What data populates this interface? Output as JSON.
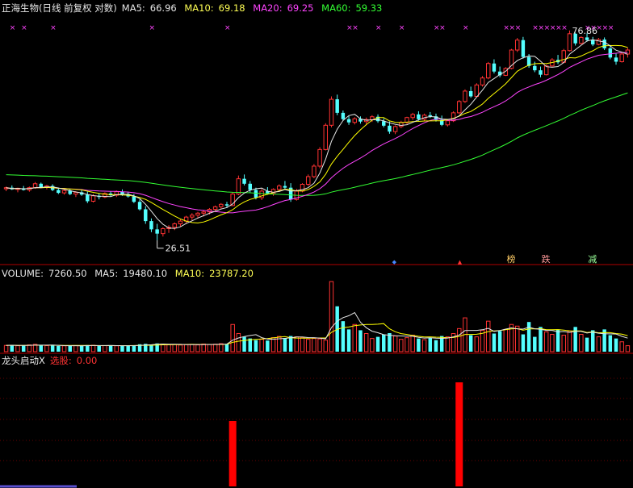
{
  "price_header": {
    "title": "正海生物(日线 前复权 对数)",
    "ma5_label": "MA5:",
    "ma5": "66.96",
    "ma10_label": "MA10:",
    "ma10": "69.18",
    "ma20_label": "MA20:",
    "ma20": "69.25",
    "ma60_label": "MA60:",
    "ma60": "59.33"
  },
  "volume_header": {
    "volume_label": "VOLUME:",
    "volume": "7260.50",
    "ma5_label": "MA5:",
    "ma5": "19480.10",
    "ma10_label": "MA10:",
    "ma10": "23787.20"
  },
  "indicator_header": {
    "name": "龙头启动X",
    "signal_label": "选股:",
    "signal_value": "0.00"
  },
  "annotations": {
    "low_price": "26.51",
    "high_price": "76.86"
  },
  "event_tags": [
    "榜",
    "跌",
    "减"
  ],
  "colors": {
    "background": "#000000",
    "up": "#ff3232",
    "down": "#54ffff",
    "ma5": "#e6e6e6",
    "ma10": "#ffff00",
    "ma20": "#ff44ff",
    "ma60": "#33ff33",
    "separator": "#b00000",
    "signal_bar": "#ff0000"
  },
  "chart_data": [
    {
      "type": "candlestick",
      "scale": "log",
      "ylim": [
        24,
        82
      ],
      "ma_series": [
        {
          "name": "MA5",
          "last": 66.96
        },
        {
          "name": "MA10",
          "last": 69.18
        },
        {
          "name": "MA20",
          "last": 69.25
        },
        {
          "name": "MA60",
          "last": 59.33
        }
      ],
      "candles": [
        [
          34.4,
          34.8,
          34.0,
          34.6
        ],
        [
          34.6,
          35.0,
          34.2,
          34.3
        ],
        [
          34.3,
          34.6,
          33.8,
          34.5
        ],
        [
          34.5,
          34.9,
          34.1,
          34.2
        ],
        [
          34.2,
          34.8,
          33.9,
          34.6
        ],
        [
          34.6,
          35.6,
          34.4,
          35.3
        ],
        [
          35.3,
          35.5,
          34.5,
          34.7
        ],
        [
          34.7,
          35.1,
          34.3,
          34.9
        ],
        [
          34.9,
          35.2,
          34.0,
          34.2
        ],
        [
          34.2,
          34.5,
          33.5,
          33.7
        ],
        [
          33.7,
          34.3,
          33.4,
          34.1
        ],
        [
          34.1,
          34.4,
          33.3,
          33.5
        ],
        [
          33.5,
          34.0,
          33.0,
          33.8
        ],
        [
          33.8,
          34.2,
          33.2,
          33.4
        ],
        [
          33.4,
          33.9,
          32.0,
          32.3
        ],
        [
          32.3,
          33.5,
          32.1,
          33.2
        ],
        [
          33.2,
          33.6,
          32.6,
          33.0
        ],
        [
          33.0,
          33.8,
          32.8,
          33.6
        ],
        [
          33.6,
          34.0,
          33.1,
          33.3
        ],
        [
          33.3,
          34.1,
          33.0,
          33.9
        ],
        [
          33.9,
          34.3,
          33.2,
          33.5
        ],
        [
          33.5,
          33.9,
          32.9,
          33.1
        ],
        [
          33.1,
          33.5,
          32.0,
          32.2
        ],
        [
          32.2,
          32.6,
          30.8,
          31.0
        ],
        [
          31.0,
          31.5,
          28.8,
          29.2
        ],
        [
          29.2,
          29.6,
          27.6,
          28.0
        ],
        [
          28.0,
          28.8,
          26.51,
          27.4
        ],
        [
          27.4,
          28.3,
          27.0,
          28.1
        ],
        [
          28.1,
          28.6,
          27.5,
          28.3
        ],
        [
          28.3,
          29.0,
          27.9,
          28.8
        ],
        [
          28.8,
          29.5,
          28.4,
          29.2
        ],
        [
          29.2,
          30.0,
          28.9,
          29.8
        ],
        [
          29.8,
          30.4,
          29.3,
          30.1
        ],
        [
          30.1,
          30.6,
          29.6,
          30.4
        ],
        [
          30.4,
          30.9,
          29.9,
          30.6
        ],
        [
          30.6,
          31.2,
          30.2,
          31.0
        ],
        [
          31.0,
          31.6,
          30.6,
          31.4
        ],
        [
          31.4,
          32.0,
          31.0,
          31.8
        ],
        [
          31.8,
          32.2,
          31.2,
          31.6
        ],
        [
          31.6,
          33.8,
          31.5,
          33.5
        ],
        [
          33.5,
          36.8,
          33.3,
          36.2
        ],
        [
          36.2,
          37.0,
          35.0,
          35.3
        ],
        [
          35.3,
          35.8,
          33.8,
          34.2
        ],
        [
          34.2,
          34.6,
          32.6,
          32.9
        ],
        [
          32.9,
          34.4,
          32.5,
          34.0
        ],
        [
          34.0,
          34.7,
          33.4,
          33.6
        ],
        [
          33.6,
          34.5,
          33.2,
          34.3
        ],
        [
          34.3,
          35.2,
          33.9,
          34.9
        ],
        [
          34.9,
          35.8,
          34.3,
          34.6
        ],
        [
          34.6,
          35.4,
          32.2,
          32.6
        ],
        [
          32.6,
          34.4,
          32.4,
          34.0
        ],
        [
          34.0,
          35.4,
          33.8,
          35.2
        ],
        [
          35.2,
          37.0,
          34.9,
          36.6
        ],
        [
          36.6,
          39.0,
          36.3,
          38.6
        ],
        [
          38.6,
          42.5,
          38.2,
          42.0
        ],
        [
          42.0,
          48.0,
          41.8,
          47.5
        ],
        [
          47.5,
          55.0,
          47.0,
          54.2
        ],
        [
          54.2,
          55.5,
          50.0,
          50.6
        ],
        [
          50.6,
          51.2,
          48.6,
          49.0
        ],
        [
          49.0,
          49.8,
          47.6,
          48.2
        ],
        [
          48.2,
          49.5,
          47.7,
          49.1
        ],
        [
          49.1,
          49.7,
          47.9,
          48.4
        ],
        [
          48.4,
          49.4,
          47.5,
          48.9
        ],
        [
          48.9,
          50.0,
          48.3,
          49.6
        ],
        [
          49.6,
          50.2,
          48.1,
          48.5
        ],
        [
          48.5,
          49.2,
          47.0,
          47.4
        ],
        [
          47.4,
          48.4,
          45.5,
          46.0
        ],
        [
          46.0,
          47.5,
          45.4,
          47.2
        ],
        [
          47.2,
          48.6,
          46.8,
          48.2
        ],
        [
          48.2,
          49.6,
          47.8,
          49.4
        ],
        [
          49.4,
          50.6,
          48.8,
          50.2
        ],
        [
          50.2,
          51.0,
          48.6,
          49.0
        ],
        [
          49.0,
          50.4,
          48.6,
          50.0
        ],
        [
          50.0,
          50.8,
          49.3,
          49.7
        ],
        [
          49.7,
          50.4,
          48.4,
          48.8
        ],
        [
          48.8,
          49.9,
          47.3,
          47.6
        ],
        [
          47.6,
          49.0,
          47.2,
          48.6
        ],
        [
          48.6,
          51.0,
          48.3,
          50.6
        ],
        [
          50.6,
          54.0,
          50.3,
          53.6
        ],
        [
          53.6,
          57.0,
          53.2,
          56.5
        ],
        [
          56.5,
          57.8,
          54.6,
          55.0
        ],
        [
          55.0,
          58.8,
          54.7,
          58.3
        ],
        [
          58.3,
          61.0,
          57.8,
          60.4
        ],
        [
          60.4,
          65.5,
          60.0,
          65.0
        ],
        [
          65.0,
          66.4,
          61.8,
          62.4
        ],
        [
          62.4,
          64.0,
          60.6,
          61.2
        ],
        [
          61.2,
          63.8,
          61.0,
          63.4
        ],
        [
          63.4,
          70.0,
          63.1,
          69.6
        ],
        [
          69.6,
          74.0,
          68.9,
          73.2
        ],
        [
          73.2,
          74.4,
          66.6,
          67.2
        ],
        [
          67.2,
          68.2,
          63.6,
          64.2
        ],
        [
          64.2,
          65.6,
          62.2,
          62.8
        ],
        [
          62.8,
          64.0,
          60.6,
          61.4
        ],
        [
          61.4,
          64.6,
          61.2,
          64.2
        ],
        [
          64.2,
          66.8,
          63.9,
          66.2
        ],
        [
          66.2,
          67.9,
          64.8,
          65.4
        ],
        [
          65.4,
          70.0,
          65.1,
          69.4
        ],
        [
          69.4,
          76.86,
          69.1,
          75.6
        ],
        [
          75.6,
          76.0,
          71.2,
          72.0
        ],
        [
          72.0,
          74.6,
          71.6,
          74.2
        ],
        [
          74.2,
          75.8,
          72.6,
          73.2
        ],
        [
          73.2,
          74.4,
          71.0,
          71.6
        ],
        [
          71.6,
          74.0,
          71.3,
          73.4
        ],
        [
          73.4,
          74.2,
          69.6,
          70.2
        ],
        [
          70.2,
          71.4,
          66.4,
          67.0
        ],
        [
          67.0,
          68.4,
          64.6,
          65.6
        ],
        [
          65.6,
          68.6,
          65.3,
          68.2
        ],
        [
          68.2,
          70.4,
          67.0,
          69.6
        ]
      ]
    },
    {
      "type": "bar",
      "name": "VOLUME",
      "last": 7260.5,
      "ma5_last": 19480.1,
      "ma10_last": 23787.2,
      "values": [
        7600,
        8000,
        7200,
        7500,
        8200,
        8900,
        7600,
        7300,
        7900,
        7000,
        7100,
        6900,
        7400,
        7200,
        8000,
        7800,
        7000,
        7300,
        7600,
        7100,
        7200,
        6900,
        7800,
        9000,
        9500,
        8600,
        10000,
        9200,
        8400,
        8700,
        8100,
        8600,
        8900,
        8200,
        9300,
        8700,
        9100,
        9700,
        9400,
        33000,
        22000,
        18000,
        16000,
        14000,
        15000,
        13500,
        17000,
        18500,
        16500,
        19000,
        18000,
        17000,
        15000,
        16000,
        15500,
        14000,
        85000,
        55000,
        37000,
        27000,
        33000,
        26000,
        22000,
        16000,
        18000,
        21000,
        22500,
        19000,
        15000,
        17000,
        20000,
        16000,
        14500,
        17000,
        14000,
        19000,
        18000,
        22000,
        28000,
        41000,
        20000,
        18000,
        26000,
        37000,
        22000,
        25000,
        27000,
        33000,
        31000,
        21000,
        36000,
        18000,
        30000,
        24000,
        21000,
        27000,
        20000,
        25000,
        30000,
        21000,
        17000,
        26000,
        18000,
        27000,
        20000,
        16000,
        12000,
        7260
      ]
    },
    {
      "type": "bar",
      "name": "龙头启动X",
      "signal_days": [
        39,
        78
      ],
      "values_at_signal": [
        1.0,
        1.6
      ]
    }
  ]
}
